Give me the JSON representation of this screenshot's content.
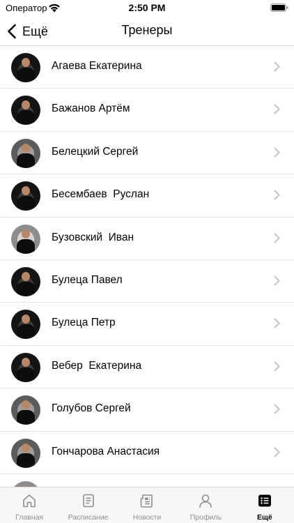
{
  "status_bar": {
    "carrier": "Оператор",
    "time": "2:50 PM"
  },
  "nav": {
    "back_label": "Ещё",
    "title": "Тренеры"
  },
  "trainers": [
    {
      "name": "Агаева Екатерина"
    },
    {
      "name": "Бажанов Артём"
    },
    {
      "name": "Белецкий Сергей"
    },
    {
      "name": "Бесембаев  Руслан"
    },
    {
      "name": "Бузовский  Иван"
    },
    {
      "name": "Булеца Павел"
    },
    {
      "name": "Булеца Петр"
    },
    {
      "name": "Вебер  Екатерина"
    },
    {
      "name": "Голубов Сергей"
    },
    {
      "name": "Гончарова Анастасия"
    },
    {
      "name": ""
    }
  ],
  "tab_bar": {
    "tabs": [
      {
        "label": "Главная",
        "icon": "home-icon"
      },
      {
        "label": "Расписание",
        "icon": "schedule-icon"
      },
      {
        "label": "Новости",
        "icon": "news-icon"
      },
      {
        "label": "Профиль",
        "icon": "profile-icon"
      },
      {
        "label": "Ещё",
        "icon": "more-icon",
        "active": true
      }
    ]
  },
  "colors": {
    "active_tab": "#000000",
    "inactive_tab": "#8e8e93",
    "separator": "#e1e1e1",
    "chevron": "#c4c4c7"
  }
}
